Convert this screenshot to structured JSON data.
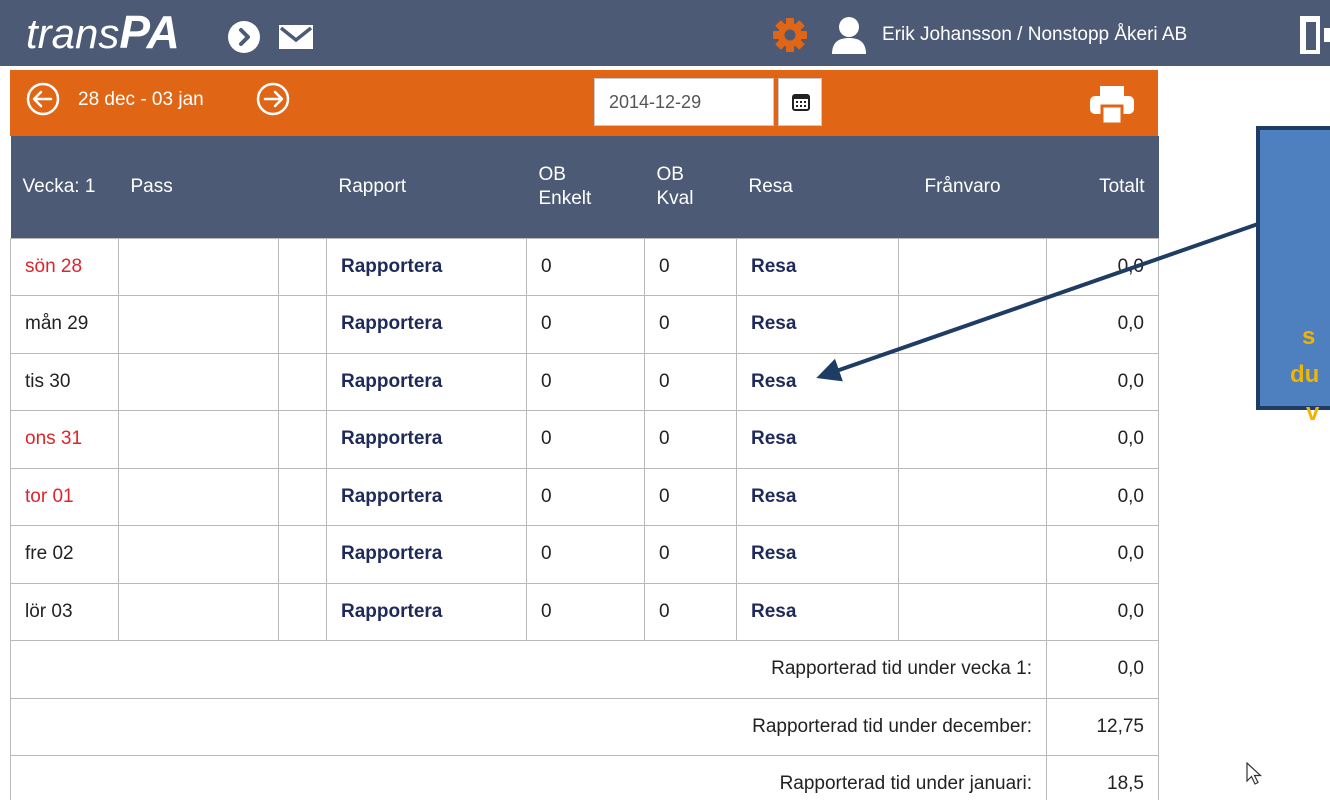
{
  "header": {
    "logo_trans": "trans",
    "logo_pa": "PA",
    "user": "Erik Johansson / Nonstopp Åkeri AB",
    "icons": [
      "chevron-circle-icon",
      "mail-icon",
      "gear-icon",
      "user-icon",
      "logout-icon"
    ],
    "colors": {
      "bar": "#4c5a76",
      "gear": "#e06616"
    }
  },
  "weekbar": {
    "range": "28 dec - 03 jan",
    "date_value": "2014-12-29",
    "icons": [
      "prev-week-icon",
      "next-week-icon",
      "calendar-icon",
      "print-icon"
    ],
    "color": "#e06616"
  },
  "table": {
    "columns": {
      "week": "Vecka: 1",
      "pass": "Pass",
      "rapport": "Rapport",
      "ob_enkelt_1": "OB",
      "ob_enkelt_2": "Enkelt",
      "ob_kval_1": "OB",
      "ob_kval_2": "Kval",
      "resa": "Resa",
      "franvaro": "Frånvaro",
      "totalt": "Totalt"
    },
    "rows": [
      {
        "day": "sön 28",
        "holiday": true,
        "rapport": "Rapportera",
        "ob_enkelt": "0",
        "ob_kval": "0",
        "resa": "Resa",
        "totalt": "0,0"
      },
      {
        "day": "mån 29",
        "holiday": false,
        "rapport": "Rapportera",
        "ob_enkelt": "0",
        "ob_kval": "0",
        "resa": "Resa",
        "totalt": "0,0"
      },
      {
        "day": "tis 30",
        "holiday": false,
        "rapport": "Rapportera",
        "ob_enkelt": "0",
        "ob_kval": "0",
        "resa": "Resa",
        "totalt": "0,0"
      },
      {
        "day": "ons 31",
        "holiday": true,
        "rapport": "Rapportera",
        "ob_enkelt": "0",
        "ob_kval": "0",
        "resa": "Resa",
        "totalt": "0,0"
      },
      {
        "day": "tor 01",
        "holiday": true,
        "rapport": "Rapportera",
        "ob_enkelt": "0",
        "ob_kval": "0",
        "resa": "Resa",
        "totalt": "0,0"
      },
      {
        "day": "fre 02",
        "holiday": false,
        "rapport": "Rapportera",
        "ob_enkelt": "0",
        "ob_kval": "0",
        "resa": "Resa",
        "totalt": "0,0"
      },
      {
        "day": "lör 03",
        "holiday": false,
        "rapport": "Rapportera",
        "ob_enkelt": "0",
        "ob_kval": "0",
        "resa": "Resa",
        "totalt": "0,0"
      }
    ],
    "summary": [
      {
        "label": "Rapporterad tid under vecka 1:",
        "value": "0,0"
      },
      {
        "label": "Rapporterad tid under december:",
        "value": "12,75"
      },
      {
        "label": "Rapporterad tid under januari:",
        "value": "18,5"
      }
    ],
    "holiday_color": "#e0232b",
    "link_color": "#1f2a5a"
  },
  "callout": {
    "lines": [
      "s",
      "du",
      "v"
    ],
    "text_color": "#f1b400",
    "fill": "#4e7fbf"
  }
}
